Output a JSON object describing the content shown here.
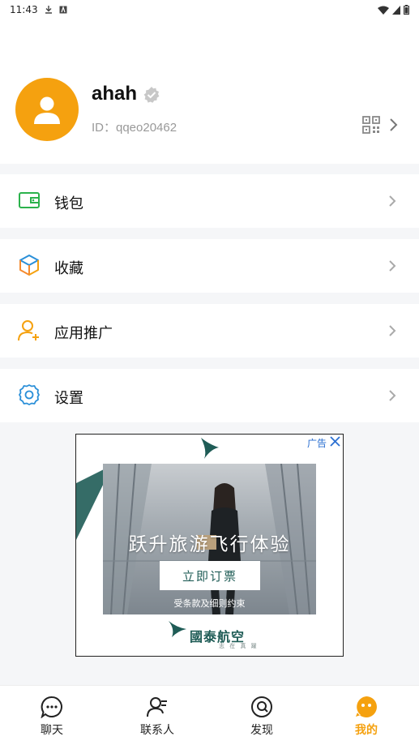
{
  "status_bar": {
    "time": "11:43"
  },
  "profile": {
    "username": "ahah",
    "user_id": "ID：qqeo20462"
  },
  "menu": [
    {
      "label": "钱包",
      "icon": "wallet-icon"
    },
    {
      "label": "收藏",
      "icon": "favorites-cube-icon"
    },
    {
      "label": "应用推广",
      "icon": "add-user-icon"
    },
    {
      "label": "设置",
      "icon": "gear-icon"
    }
  ],
  "ad": {
    "tag": "广告",
    "headline": "跃升旅游飞行体验",
    "cta": "立即订票",
    "terms": "受条款及细则约束",
    "brand": "國泰航空",
    "slogan": "志 在 真 躍"
  },
  "tabs": [
    {
      "label": "聊天",
      "icon": "chat-bubble-icon"
    },
    {
      "label": "联系人",
      "icon": "contacts-icon"
    },
    {
      "label": "发现",
      "icon": "discover-icon"
    },
    {
      "label": "我的",
      "icon": "me-icon",
      "active": true
    }
  ],
  "colors": {
    "accent": "#f5a10f",
    "wallet": "#2bb24c",
    "link": "#2a6fd1",
    "brand": "#1f5c56"
  }
}
